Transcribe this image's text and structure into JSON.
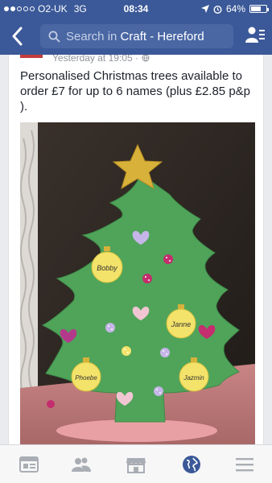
{
  "status_bar": {
    "carrier": "O2-UK",
    "network": "3G",
    "time": "08:34",
    "battery": "64%",
    "battery_level": 0.64
  },
  "nav": {
    "search_prefix": "Search in ",
    "search_group": "Craft - Hereford"
  },
  "post": {
    "timestamp": "Yesterday at 19:05 ·",
    "text": "Personalised Christmas trees available to order £7 for up to 6 names (plus £2.85 p&p ).",
    "photo": {
      "baubles": [
        "Bobby",
        "Janne",
        "Phoebe",
        "Jazmin"
      ]
    }
  },
  "tabbar": {
    "items": [
      "news-feed",
      "groups",
      "marketplace",
      "notifications",
      "more"
    ]
  },
  "colors": {
    "brand": "#3b5998",
    "tree": "#4fa45a",
    "star": "#d8b13a",
    "bauble": "#f4e36a",
    "tab_active": "#3b5998",
    "tab_inactive": "#a9adb4"
  }
}
